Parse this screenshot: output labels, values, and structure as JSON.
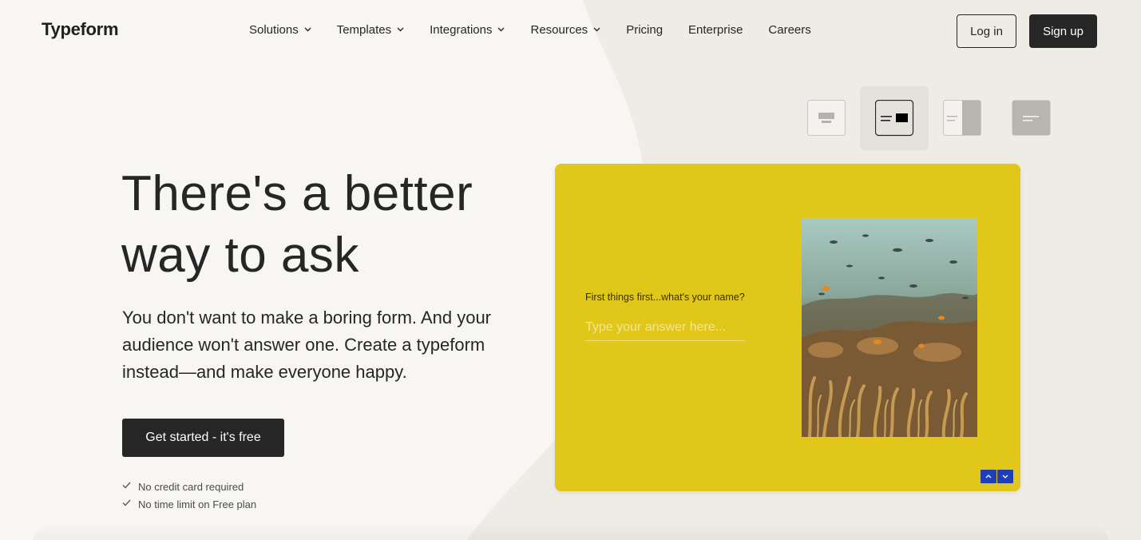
{
  "header": {
    "logo": "Typeform",
    "nav": [
      {
        "label": "Solutions",
        "dropdown": true
      },
      {
        "label": "Templates",
        "dropdown": true
      },
      {
        "label": "Integrations",
        "dropdown": true
      },
      {
        "label": "Resources",
        "dropdown": true
      },
      {
        "label": "Pricing",
        "dropdown": false
      },
      {
        "label": "Enterprise",
        "dropdown": false
      },
      {
        "label": "Careers",
        "dropdown": false
      }
    ],
    "login_label": "Log in",
    "signup_label": "Sign up"
  },
  "hero": {
    "title_line1": "There's a better",
    "title_line2": "way to ask",
    "subtitle": "You don't want to make a boring form. And your audience won't answer one. Create a typeform instead—and make everyone happy.",
    "cta_label": "Get started - it's free",
    "checks": [
      "No credit card required",
      "No time limit on Free plan"
    ]
  },
  "layout_switcher": {
    "options": [
      "layout-stack-icon",
      "layout-split-icon",
      "layout-side-image-icon",
      "layout-wallpaper-icon"
    ],
    "selected_index": 1
  },
  "preview": {
    "question": "First things first...what's your name?",
    "answer_placeholder": "Type your answer here...",
    "background": "#e1c71a",
    "arrow_color": "#1f3fb8"
  },
  "colors": {
    "page_bg": "#f7f6f3",
    "blob": "#efebe5",
    "dark": "#262627"
  }
}
